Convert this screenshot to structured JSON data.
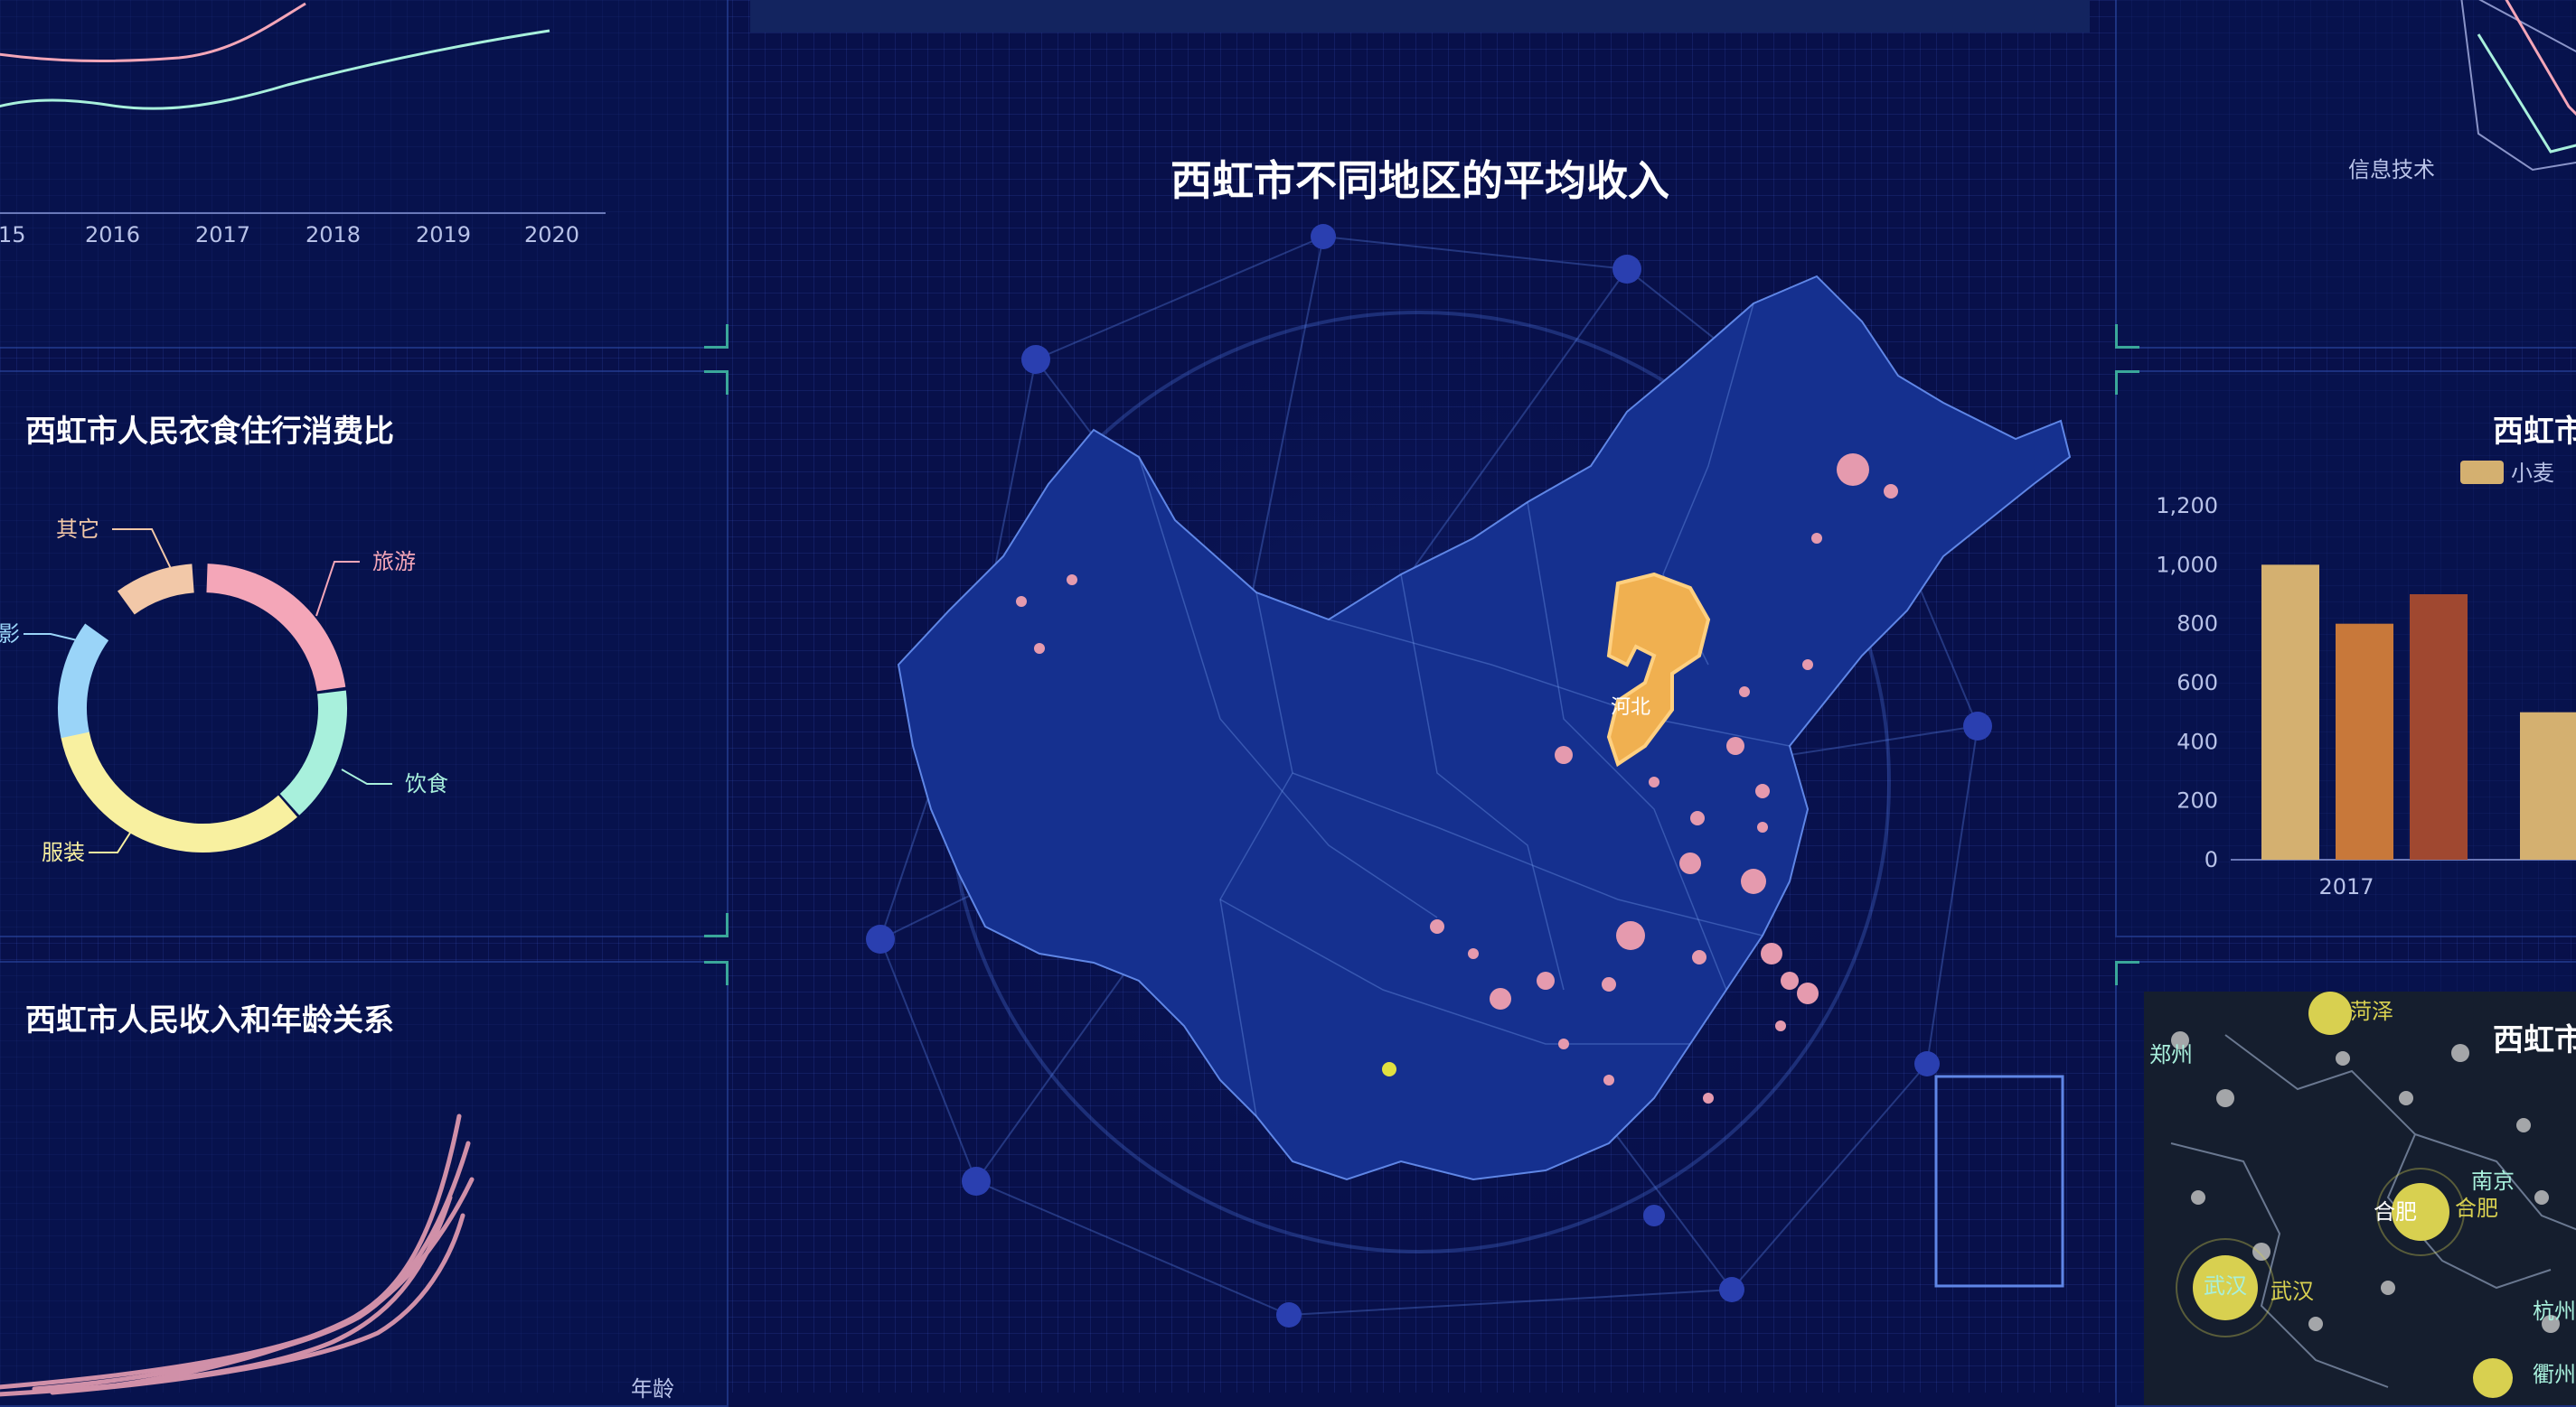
{
  "line_panel": {
    "x_ticks": [
      "15",
      "2016",
      "2017",
      "2018",
      "2019",
      "2020"
    ]
  },
  "consumption_panel": {
    "title": "西虹市人民衣食住行消费比",
    "labels": {
      "other": "其它",
      "travel": "旅游",
      "movie": "影",
      "food": "饮食",
      "clothing": "服装"
    }
  },
  "income_age_panel": {
    "title": "西虹市人民收入和年龄关系",
    "x_axis_label": "年龄"
  },
  "map_panel": {
    "title": "西虹市不同地区的平均收入",
    "highlight_label": "河北"
  },
  "radar_panel": {
    "label": "信息技术"
  },
  "bar_panel": {
    "title": "西虹市",
    "legend": "小麦",
    "y_ticks": [
      "0",
      "200",
      "400",
      "600",
      "800",
      "1,000",
      "1,200"
    ],
    "x_label": "2017"
  },
  "geo_panel": {
    "title": "西虹市",
    "cities": [
      "郑州",
      "菏泽",
      "南京",
      "合肥",
      "合肥",
      "武汉",
      "武汉",
      "杭州",
      "衢州"
    ]
  },
  "colors": {
    "background": "#08104a",
    "accent": "#3aa79a",
    "pink": "#f4a6b8",
    "mint": "#a8f0dc",
    "yellow": "#f8f0a0",
    "sky": "#9ad4f8",
    "peach": "#f2c8a8",
    "map_fill": "#15308f",
    "highlight": "#f0b050"
  },
  "chart_data": [
    {
      "type": "bar",
      "categories": [
        "2017"
      ],
      "series": [
        {
          "name": "小麦",
          "values": [
            1000
          ]
        },
        {
          "values": [
            800
          ]
        },
        {
          "values": [
            900
          ]
        },
        {
          "values": [
            500
          ]
        }
      ],
      "ylim": [
        0,
        1200
      ]
    },
    {
      "type": "pie",
      "labels": [
        "旅游",
        "饮食",
        "服装",
        "影",
        "其它"
      ],
      "values": [
        22,
        15,
        35,
        15,
        8
      ]
    }
  ]
}
